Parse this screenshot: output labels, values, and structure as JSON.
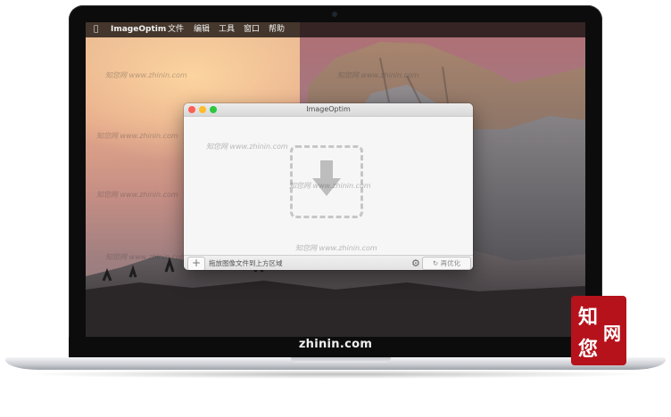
{
  "menubar": {
    "apple_icon": "",
    "app_name": "ImageOptim",
    "items": [
      "文件",
      "编辑",
      "工具",
      "窗口",
      "帮助"
    ]
  },
  "window": {
    "title": "ImageOptim",
    "hint": "拖放图像文件到上方区域",
    "plus_label": "+",
    "reoptimize_label": "再优化",
    "traffic_lights": [
      "#fd5f57",
      "#febb2e",
      "#2bc840"
    ]
  },
  "watermark": {
    "text": "知您网 www.zhinin.com",
    "short_text": "知您网 www.zhinin.com"
  },
  "brand": "zhinin.com",
  "logo": {
    "chars": [
      "知",
      "您",
      "网"
    ],
    "color": "#b5121b"
  },
  "icons": {
    "drop_arrow": "download-arrow-icon",
    "gear": "gear-icon",
    "refresh": "refresh-icon"
  }
}
